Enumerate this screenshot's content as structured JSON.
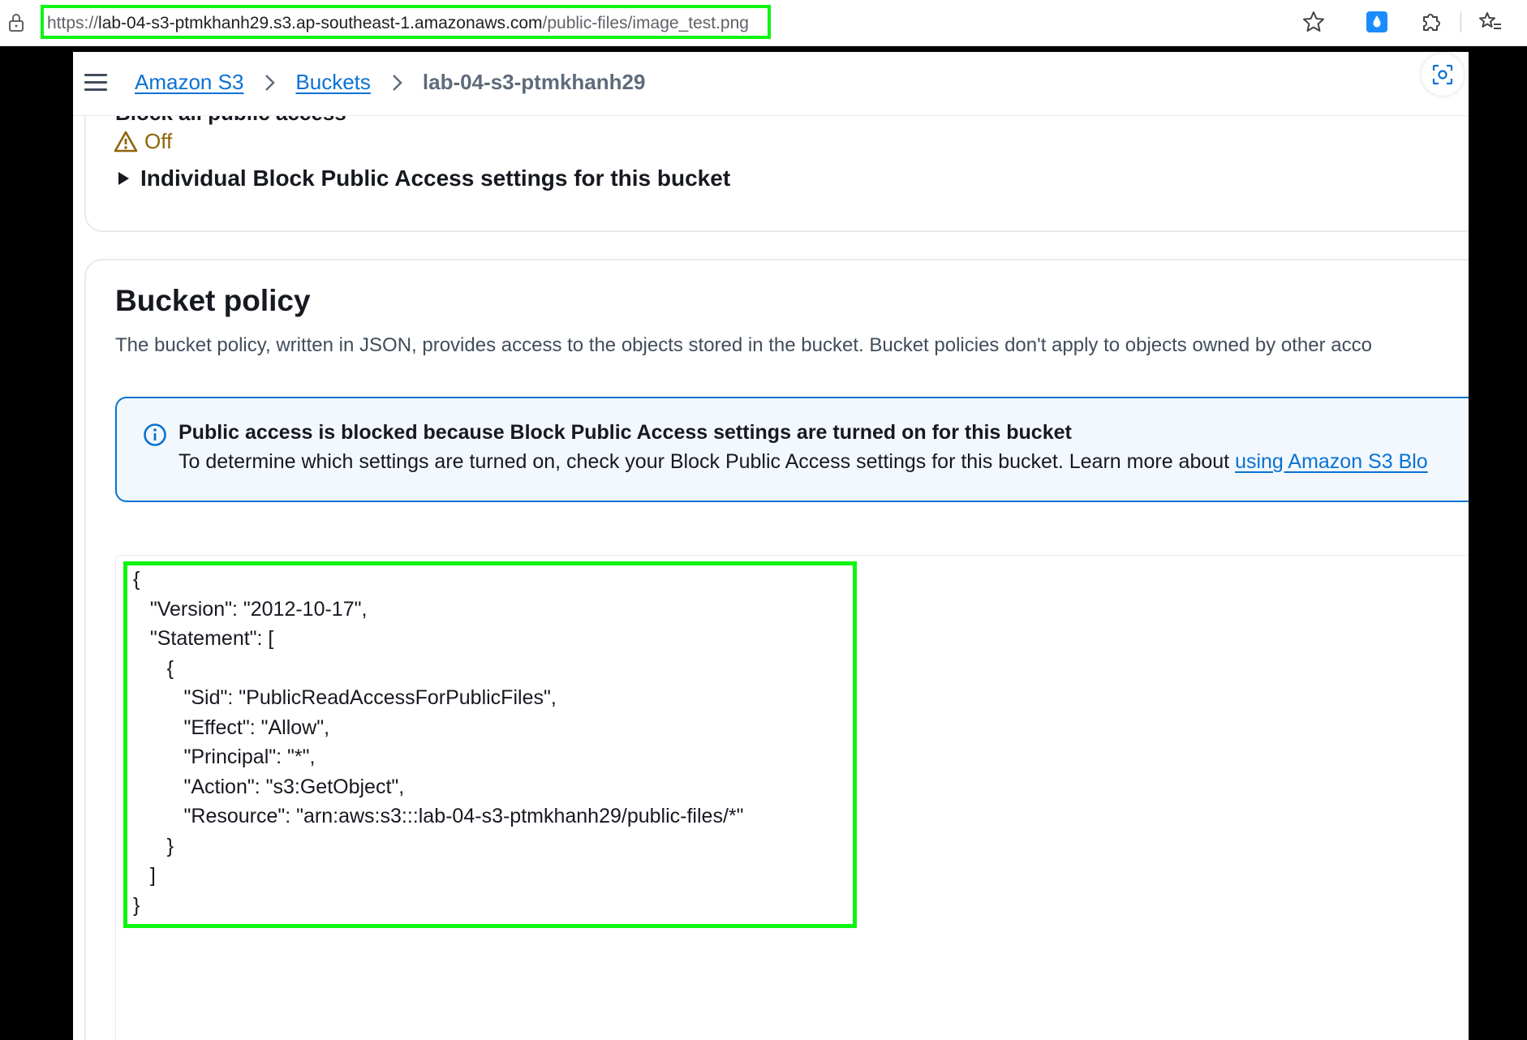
{
  "browser": {
    "url_scheme": "https://",
    "url_host": "lab-04-s3-ptmkhanh29.s3.ap-southeast-1.amazonaws.com",
    "url_path": "/public-files/image_test.png"
  },
  "nav": {
    "breadcrumbs": [
      "Amazon S3",
      "Buckets"
    ],
    "current": "lab-04-s3-ptmkhanh29"
  },
  "block_public_access": {
    "heading": "Block all public access",
    "status": "Off",
    "expander_label": "Individual Block Public Access settings for this bucket"
  },
  "bucket_policy": {
    "title": "Bucket policy",
    "description": "The bucket policy, written in JSON, provides access to the objects stored in the bucket. Bucket policies don't apply to objects owned by other acco",
    "alert": {
      "title": "Public access is blocked because Block Public Access settings are turned on for this bucket",
      "body": "To determine which settings are turned on, check your Block Public Access settings for this bucket. Learn more about ",
      "link": "using Amazon S3 Blo"
    },
    "policy_json": "{\n   \"Version\": \"2012-10-17\",\n   \"Statement\": [\n      {\n         \"Sid\": \"PublicReadAccessForPublicFiles\",\n         \"Effect\": \"Allow\",\n         \"Principal\": \"*\",\n         \"Action\": \"s3:GetObject\",\n         \"Resource\": \"arn:aws:s3:::lab-04-s3-ptmkhanh29/public-files/*\"\n      }\n   ]\n}"
  },
  "colors": {
    "accent": "#0972d3",
    "warning": "#8d6605",
    "highlight": "#0ef511"
  }
}
